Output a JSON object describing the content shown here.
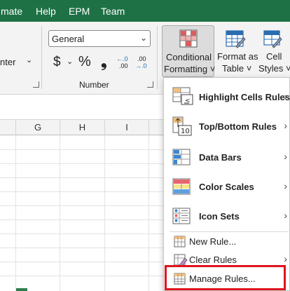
{
  "menubar": {
    "items": [
      "mate",
      "Help",
      "EPM",
      "Team"
    ]
  },
  "ribbon": {
    "alignment_fragment": "nter",
    "number_format_value": "General",
    "number_group_label": "Number",
    "currency_symbol": "$",
    "percent_symbol": "%",
    "comma_symbol": "❟",
    "increase_decimal_top": "←.0",
    "increase_decimal_bottom": ".00",
    "decrease_decimal_top": ".00",
    "decrease_decimal_bottom": "→.0",
    "conditional_formatting_line1": "Conditional",
    "conditional_formatting_line2": "Formatting ˅",
    "format_as_table_line1": "Format as",
    "format_as_table_line2": "Table ˅",
    "cell_styles_line1": "Cell",
    "cell_styles_line2": "Styles ˅"
  },
  "sheet": {
    "columns": [
      "G",
      "H",
      "I"
    ]
  },
  "menu": {
    "highlight_cells_rules": "Highlight Cells Rules",
    "top_bottom_rules": "Top/Bottom Rules",
    "data_bars": "Data Bars",
    "color_scales": "Color Scales",
    "icon_sets": "Icon Sets",
    "new_rule": "New Rule...",
    "clear_rules": "Clear Rules",
    "manage_rules": "Manage Rules...",
    "arrow": "›",
    "top10_icon_text": "10"
  },
  "colors": {
    "menubar_bg": "#1e7145",
    "highlight_red": "#e0141e"
  }
}
